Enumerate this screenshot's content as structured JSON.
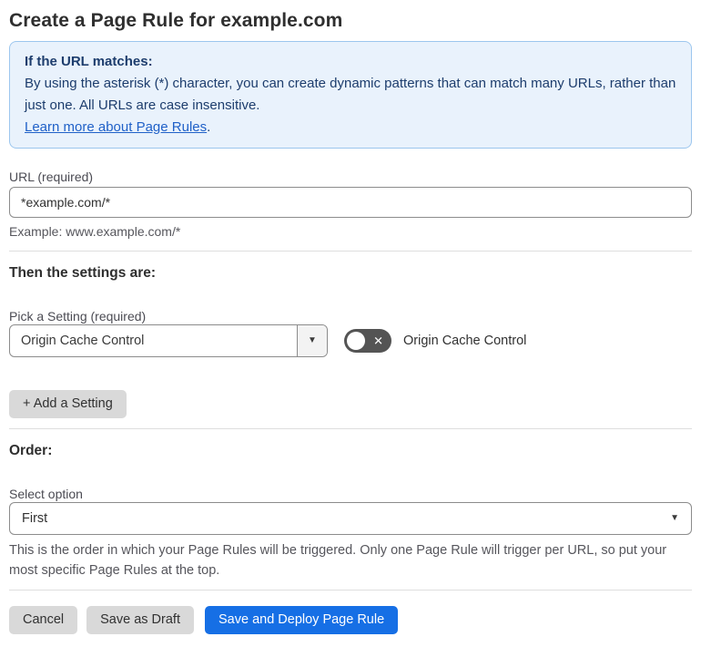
{
  "page": {
    "title": "Create a Page Rule for example.com"
  },
  "info_box": {
    "heading": "If the URL matches:",
    "body": "By using the asterisk (*) character, you can create dynamic patterns that can match many URLs, rather than just one. All URLs are case insensitive.",
    "link_label": "Learn more about Page Rules",
    "link_suffix": "."
  },
  "url_field": {
    "label": "URL (required)",
    "value": "*example.com/*",
    "helper": "Example: www.example.com/*"
  },
  "settings_section": {
    "heading": "Then the settings are:",
    "picker_label": "Pick a Setting (required)",
    "picker_value": "Origin Cache Control",
    "picker_caret": "▼",
    "toggle_state": "off",
    "toggle_glyph": "✕",
    "toggle_label": "Origin Cache Control",
    "add_setting_label": "+ Add a Setting"
  },
  "order_section": {
    "heading": "Order:",
    "select_label": "Select option",
    "select_value": "First",
    "select_caret": "▼",
    "helper": "This is the order in which your Page Rules will be triggered. Only one Page Rule will trigger per URL, so put your most specific Page Rules at the top."
  },
  "footer": {
    "cancel_label": "Cancel",
    "save_draft_label": "Save as Draft",
    "save_deploy_label": "Save and Deploy Page Rule"
  },
  "colors": {
    "accent_blue": "#166fe5",
    "info_box_bg": "#e9f2fc",
    "info_box_border": "#9cc6ee",
    "info_box_text": "#1d3d6d",
    "link_blue": "#2061c8",
    "toggle_off_bg": "#545454",
    "gray_button_bg": "#d9d9d9"
  }
}
